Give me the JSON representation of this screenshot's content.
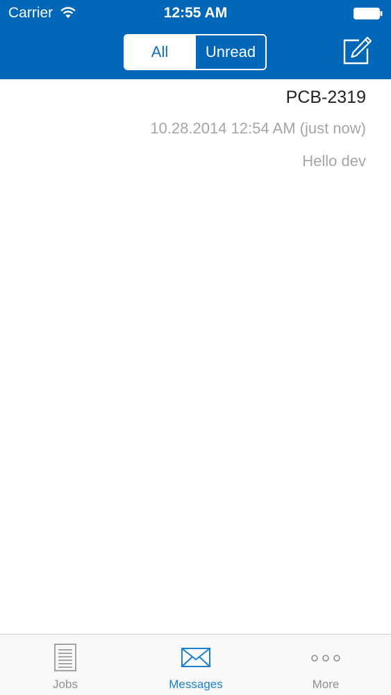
{
  "status_bar": {
    "carrier": "Carrier",
    "time": "12:55 AM"
  },
  "nav": {
    "segments": [
      "All",
      "Unread"
    ],
    "selected_segment": "All",
    "compose_icon": "compose-icon"
  },
  "messages": [
    {
      "title": "PCB-2319",
      "date": "10.28.2014 12:54 AM (just now)",
      "body": "Hello dev"
    }
  ],
  "tab_bar": {
    "tabs": [
      {
        "label": "Jobs",
        "icon": "document-icon",
        "active": false
      },
      {
        "label": "Messages",
        "icon": "envelope-icon",
        "active": true
      },
      {
        "label": "More",
        "icon": "ellipsis-icon",
        "active": false
      }
    ]
  },
  "colors": {
    "nav_background": "#0066b8",
    "accent": "#1a7ed1",
    "inactive_tab": "#8e8e8e",
    "secondary_text": "#a5a5a5"
  }
}
